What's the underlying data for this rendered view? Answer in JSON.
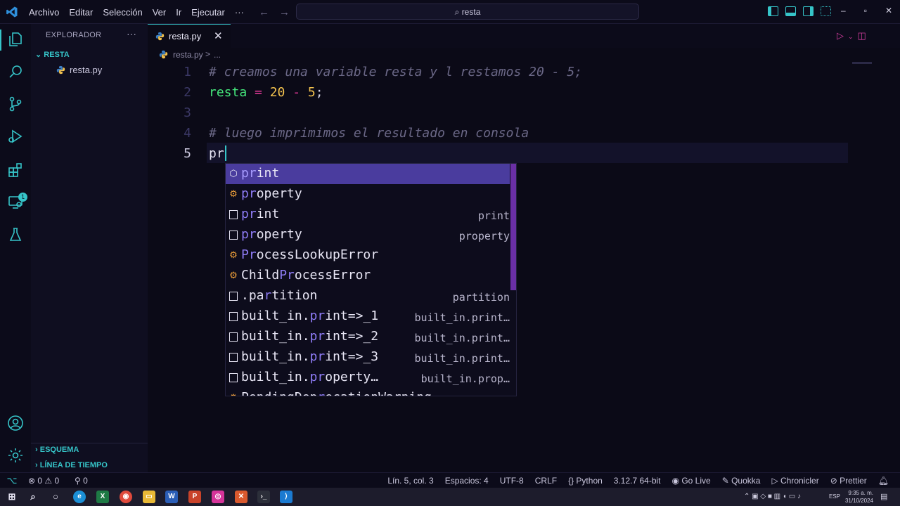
{
  "titlebar": {
    "menu": [
      "Archivo",
      "Editar",
      "Selección",
      "Ver",
      "Ir",
      "Ejecutar",
      "···"
    ],
    "search": "resta",
    "icons": [
      "toggle-primary-sidebar-icon",
      "toggle-panel-icon",
      "toggle-secondary-sidebar-icon",
      "customize-layout-icon"
    ],
    "window_controls": [
      "–",
      "▫",
      "✕"
    ]
  },
  "colors": {
    "accent": "#36c5c9",
    "selection": "#4a3c9e",
    "keyword_op": "#e83a9b",
    "variable": "#45e87c",
    "number": "#f2c14e",
    "comment": "#6b6887"
  },
  "activity_bar": {
    "items": [
      "explorer-icon",
      "search-icon",
      "source-control-icon",
      "run-debug-icon",
      "extensions-icon",
      "remote-explorer-icon",
      "testing-icon"
    ],
    "extensions_badge": "1",
    "bottom": [
      "accounts-icon",
      "manage-gear-icon"
    ]
  },
  "sidebar": {
    "title": "EXPLORADOR",
    "more": "···",
    "folder": "RESTA",
    "file": "resta.py",
    "outline": "ESQUEMA",
    "timeline": "LÍNEA DE TIEMPO"
  },
  "tabs": [
    {
      "label": "resta.py",
      "close": "✕"
    }
  ],
  "breadcrumb": {
    "file": "resta.py",
    "sep": ">",
    "more": "..."
  },
  "editor": {
    "lines": [
      {
        "n": "1",
        "comment": "# creamos una variable resta y l restamos 20 - 5;"
      },
      {
        "n": "2",
        "var": "resta",
        "eq": " = ",
        "a": "20",
        "minus": " - ",
        "b": "5",
        "semi": ";"
      },
      {
        "n": "3"
      },
      {
        "n": "4",
        "comment": "# luego imprimimos el resultado en consola"
      },
      {
        "n": "5",
        "text": "pr"
      }
    ]
  },
  "suggest": [
    {
      "pre": "",
      "match": "pr",
      "rest": "int",
      "detail": "",
      "kind": "method"
    },
    {
      "pre": "",
      "match": "pr",
      "rest": "operty",
      "detail": "",
      "kind": "class"
    },
    {
      "pre": "",
      "match": "pr",
      "rest": "int",
      "detail": "print",
      "kind": "snippet"
    },
    {
      "pre": "",
      "match": "pr",
      "rest": "operty",
      "detail": "property",
      "kind": "snippet"
    },
    {
      "pre": "",
      "match": "Pr",
      "rest": "ocessLookupError",
      "detail": "",
      "kind": "class"
    },
    {
      "pre": "Child",
      "match": "Pr",
      "rest": "ocessError",
      "detail": "",
      "kind": "class"
    },
    {
      "pre": ".pa",
      "match": "r",
      "rest": "tition",
      "detail": "partition",
      "kind": "snippet"
    },
    {
      "pre": "built_in.",
      "match": "pr",
      "rest": "int=>_1",
      "detail": "built_in.print…",
      "kind": "snippet"
    },
    {
      "pre": "built_in.",
      "match": "pr",
      "rest": "int=>_2",
      "detail": "built_in.print…",
      "kind": "snippet"
    },
    {
      "pre": "built_in.",
      "match": "pr",
      "rest": "int=>_3",
      "detail": "built_in.print…",
      "kind": "snippet"
    },
    {
      "pre": "built_in.",
      "match": "pr",
      "rest": "operty…",
      "detail": "built_in.prop…",
      "kind": "snippet"
    },
    {
      "pre": "PendingDep",
      "match": "r",
      "rest": "ecationWarning",
      "detail": "",
      "kind": "class"
    }
  ],
  "status": {
    "remote": "⌥",
    "errors": "0",
    "warnings": "0",
    "ports": "0",
    "right": [
      "Lín. 5, col. 3",
      "Espacios: 4",
      "UTF-8",
      "CRLF",
      "{} Python",
      "3.12.7 64-bit",
      "Go Live",
      "Quokka",
      "Chronicler",
      "Prettier"
    ]
  },
  "taskbar": {
    "lang": "ESP",
    "time": "9:35 a. m.",
    "date": "31/10/2024"
  }
}
